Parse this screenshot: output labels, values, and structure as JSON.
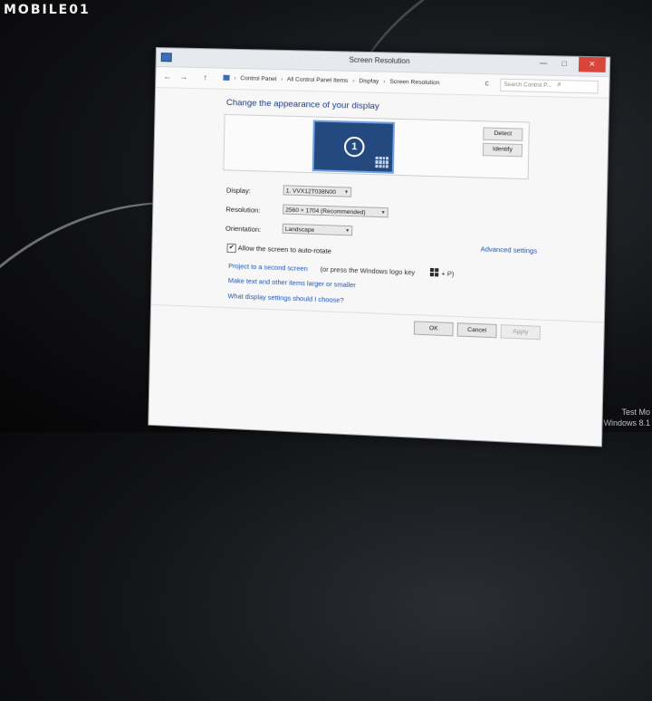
{
  "watermark": "MOBILE01",
  "window": {
    "title": "Screen Resolution",
    "minimize": "—",
    "maximize": "□",
    "close": "✕"
  },
  "address": {
    "back": "←",
    "forward": "→",
    "up": "↑",
    "breadcrumbs": [
      "Control Panel",
      "All Control Panel Items",
      "Display",
      "Screen Resolution"
    ],
    "refresh": "c",
    "search_placeholder": "Search Control P..."
  },
  "main": {
    "heading": "Change the appearance of your display",
    "monitor_number": "1",
    "detect_label": "Detect",
    "identify_label": "Identify",
    "display_label": "Display:",
    "display_value": "1. VVX12T038N00",
    "resolution_label": "Resolution:",
    "resolution_value": "2560 × 1704 (Recommended)",
    "orientation_label": "Orientation:",
    "orientation_value": "Landscape",
    "autorotate_label": "Allow the screen to auto-rotate",
    "autorotate_checked": "✔",
    "advanced_link": "Advanced settings",
    "project_link": "Project to a second screen",
    "project_hint_pre": "(or press the Windows logo key",
    "project_hint_post": "+ P)",
    "text_size_link": "Make text and other items larger or smaller",
    "help_link": "What display settings should I choose?"
  },
  "footer": {
    "ok": "OK",
    "cancel": "Cancel",
    "apply": "Apply"
  },
  "desktop": {
    "corner_line1": "Test Mo",
    "corner_line2": "Windows 8.1"
  },
  "colors": {
    "accent": "#1e3f8a",
    "link": "#2255b5",
    "close": "#d9453a",
    "monitor": "#24497f"
  }
}
